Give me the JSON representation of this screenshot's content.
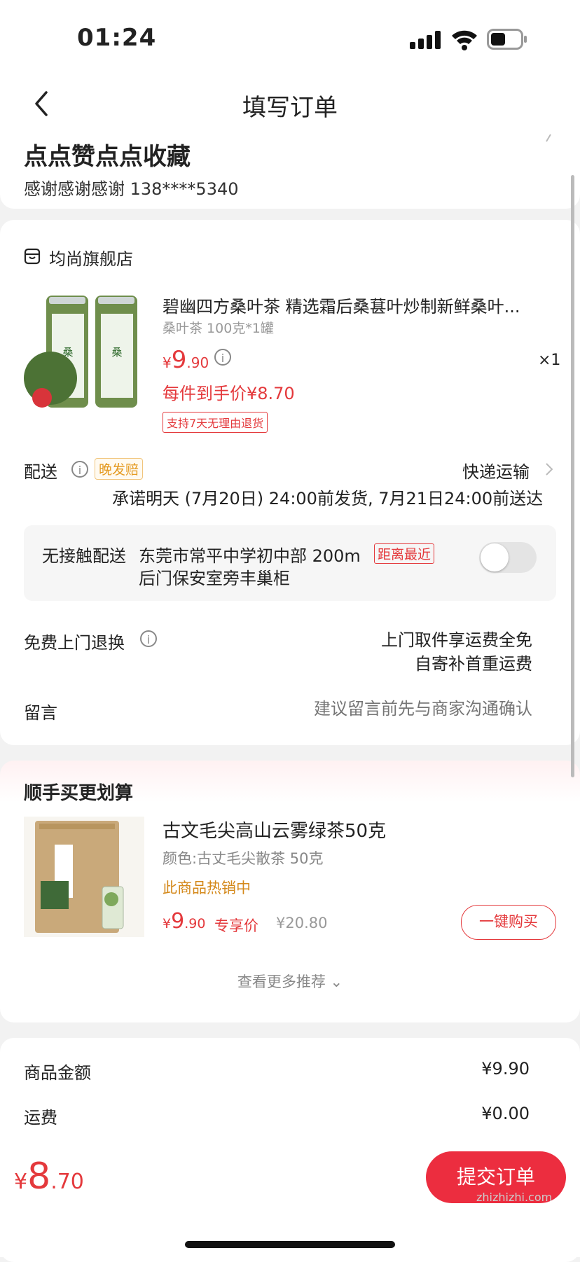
{
  "status": {
    "time": "01:24"
  },
  "nav": {
    "title": "填写订单"
  },
  "address": {
    "name": "点点赞点点收藏",
    "contact": "感谢感谢感谢  138****5340"
  },
  "store": {
    "name": "均尚旗舰店",
    "product": {
      "title": "碧幽四方桑叶茶 精选霜后桑葚叶炒制新鲜桑叶...",
      "spec": "桑叶茶 100克*1罐",
      "price_symbol": "¥",
      "price_int": "9",
      "price_dec": ".90",
      "qty": "×1",
      "final_price": "每件到手价¥8.70",
      "return_tag": "支持7天无理由退货"
    },
    "shipping": {
      "label": "配送",
      "late_tag": "晚发赔",
      "method": "快递运输",
      "promise": "承诺明天 (7月20日) 24:00前发货, 7月21日24:00前送达"
    },
    "contactless": {
      "label": "无接触配送",
      "address_line1": "东莞市常平中学初中部 200m",
      "address_line2": "后门保安室旁丰巢柜",
      "near_tag": "距离最近"
    },
    "return_service": {
      "label": "免费上门退换",
      "line1": "上门取件享运费全免",
      "line2": "自寄补首重运费"
    },
    "message": {
      "label": "留言",
      "placeholder": "建议留言前先与商家沟通确认"
    }
  },
  "recommend": {
    "title": "顺手买更划算",
    "product": {
      "name": "古文毛尖高山云雾绿茶50克",
      "spec": "颜色:古丈毛尖散茶 50克",
      "hot": "此商品热销中",
      "price_symbol": "¥",
      "price_int": "9",
      "price_dec": ".90",
      "exclusive": "专享价",
      "original": "¥20.80",
      "buy_button": "一键购买"
    },
    "more": "查看更多推荐 ⌄"
  },
  "totals": {
    "goods_label": "商品金额",
    "goods_value": "¥9.90",
    "freight_label": "运费",
    "freight_value": "¥0.00"
  },
  "bottom": {
    "price_symbol": "¥",
    "price_int": "8",
    "price_dec": ".70",
    "submit": "提交订单"
  },
  "watermark": "zhizhizhi.com"
}
